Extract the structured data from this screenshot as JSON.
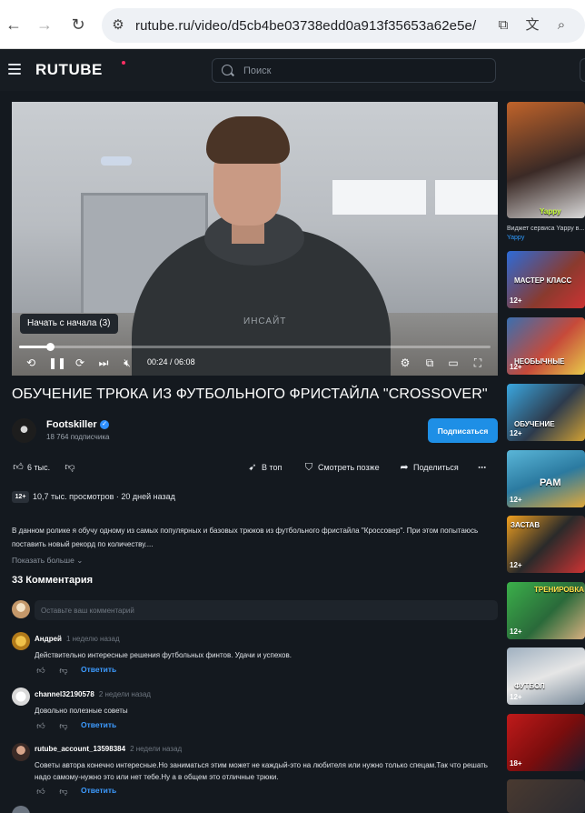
{
  "browser": {
    "url": "rutube.ru/video/d5cb4be03738edd0a913f35653a62e5e/"
  },
  "header": {
    "logo": "RUTUBE",
    "search_placeholder": "Поиск"
  },
  "player": {
    "tooltip": "Начать с начала (3)",
    "current_time": "00:24",
    "duration": "06:08",
    "progress_fraction": 0.065,
    "hoodie_print": "ИНСАЙТ"
  },
  "video": {
    "title": "ОБУЧЕНИЕ ТРЮКА ИЗ ФУТБОЛЬНОГО ФРИСТАЙЛА \"CROSSOVER\"",
    "channel_name": "Footskiller",
    "subscribers": "18 764 подписчика",
    "subscribe_label": "Подписаться",
    "likes": "6 тыс.",
    "top_label": "В топ",
    "watch_later_label": "Смотреть позже",
    "share_label": "Поделиться",
    "age_rating": "12+",
    "views": "10,7 тыс. просмотров",
    "posted": "20 дней назад",
    "description": "В данном ролике я обучу одному из самых популярных и базовых трюков из футбольного фристайла \"Кроссовер\". При этом попытаюсь поставить новый рекорд по количеству....",
    "show_more": "Показать больше"
  },
  "comments": {
    "title": "33 Комментария",
    "input_placeholder": "Оставьте ваш комментарий",
    "reply_label": "Ответить",
    "items": [
      {
        "author": "Андрей",
        "time": "1 неделю назад",
        "text": "Действительно интересные решения футбольных финтов. Удачи и успехов."
      },
      {
        "author": "channel32190578",
        "time": "2 недели назад",
        "text": "Довольно полезные советы"
      },
      {
        "author": "rutube_account_13598384",
        "time": "2 недели назад",
        "text": "Советы автора конечно интересные.Но заниматься этим может не каждый-это на любителя или нужно только спецам.Так что решать надо самому-нужно это или нет тебе.Ну а в общем это отличные трюки."
      }
    ]
  },
  "sidebar": {
    "widget_label": "Виджет сервиса Yappy в...",
    "widget_brand": "Yappy",
    "thumbs": [
      {
        "caption": "Yappy",
        "age": ""
      },
      {
        "caption": "МАСТЕР КЛАСС",
        "age": "12+"
      },
      {
        "caption": "НЕОБЫЧНЫЕ",
        "age": "12+"
      },
      {
        "caption": "ОБУЧЕНИЕ",
        "age": "12+"
      },
      {
        "caption": "РАМ",
        "age": "12+"
      },
      {
        "caption": "ЗАСТАВ",
        "age": "12+"
      },
      {
        "caption": "ТРЕНИРОВКА",
        "age": "12+"
      },
      {
        "caption": "ФУТБОЛ",
        "age": "12+"
      },
      {
        "caption": "",
        "age": "18+"
      },
      {
        "caption": "",
        "age": ""
      }
    ]
  },
  "colors": {
    "background": "#14191f",
    "accent": "#1e8fe6",
    "link": "#3d9bff"
  }
}
